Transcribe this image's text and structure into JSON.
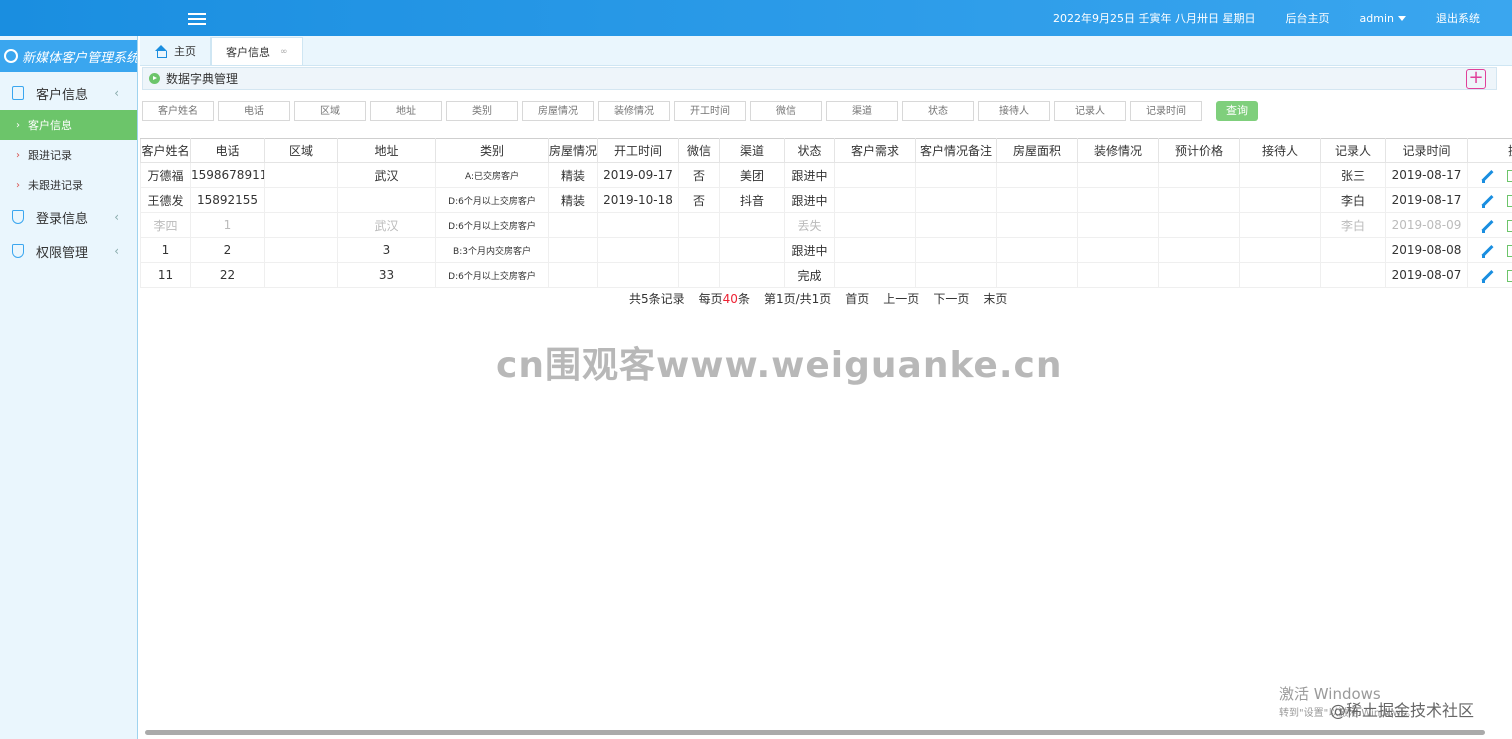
{
  "topbar": {
    "date": "2022年9月25日 壬寅年 八月卅日 星期日",
    "home_link": "后台主页",
    "user": "admin",
    "logout": "退出系统"
  },
  "sidebar": {
    "brand": "新媒体客户管理系统",
    "groups": [
      {
        "label": "客户信息"
      },
      {
        "label": "登录信息"
      },
      {
        "label": "权限管理"
      }
    ],
    "items": [
      {
        "label": "客户信息"
      },
      {
        "label": "跟进记录"
      },
      {
        "label": "未跟进记录"
      }
    ]
  },
  "tabs": {
    "home": "主页",
    "active": "客户信息",
    "close": "∞"
  },
  "breadcrumb": "数据字典管理",
  "search": {
    "placeholders": [
      "客户姓名",
      "电话",
      "区域",
      "地址",
      "类别",
      "房屋情况",
      "装修情况",
      "开工时间",
      "微信",
      "渠道",
      "状态",
      "接待人",
      "记录人",
      "记录时间"
    ],
    "button": "查询"
  },
  "table": {
    "headers": [
      "客户姓名",
      "电话",
      "区域",
      "地址",
      "类别",
      "房屋情况",
      "开工时间",
      "微信",
      "渠道",
      "状态",
      "客户需求",
      "客户情况备注",
      "房屋面积",
      "装修情况",
      "预计价格",
      "接待人",
      "记录人",
      "记录时间",
      "操"
    ],
    "rows": [
      [
        "万德福",
        "1598678911",
        "",
        "武汉",
        "A:已交房客户",
        "精装",
        "2019-09-17",
        "否",
        "美团",
        "跟进中",
        "",
        "",
        "",
        "",
        "",
        "",
        "张三",
        "2019-08-17"
      ],
      [
        "王德发",
        "15892155",
        "",
        "",
        "D:6个月以上交房客户",
        "精装",
        "2019-10-18",
        "否",
        "抖音",
        "跟进中",
        "",
        "",
        "",
        "",
        "",
        "",
        "李白",
        "2019-08-17"
      ],
      [
        "李四",
        "1",
        "",
        "武汉",
        "D:6个月以上交房客户",
        "",
        "",
        "",
        "",
        "丢失",
        "",
        "",
        "",
        "",
        "",
        "",
        "李白",
        "2019-08-09"
      ],
      [
        "1",
        "2",
        "",
        "3",
        "B:3个月内交房客户",
        "",
        "",
        "",
        "",
        "跟进中",
        "",
        "",
        "",
        "",
        "",
        "",
        "",
        "2019-08-08"
      ],
      [
        "11",
        "22",
        "",
        "33",
        "D:6个月以上交房客户",
        "",
        "",
        "",
        "",
        "完成",
        "",
        "",
        "",
        "",
        "",
        "",
        "",
        "2019-08-07"
      ]
    ]
  },
  "pager": {
    "total": "共5条记录",
    "per_page_prefix": "每页",
    "per_page_value": "40",
    "per_page_suffix": "条",
    "page": "第1页/共1页",
    "first": "首页",
    "prev": "上一页",
    "next": "下一页",
    "last": "末页"
  },
  "watermark": "cn围观客www.weiguanke.cn",
  "windows_activation": {
    "line1": "激活 Windows",
    "line2": "转到\"设置\"以激活 Windows。"
  },
  "juejin_mark": "@稀土掘金技术社区"
}
